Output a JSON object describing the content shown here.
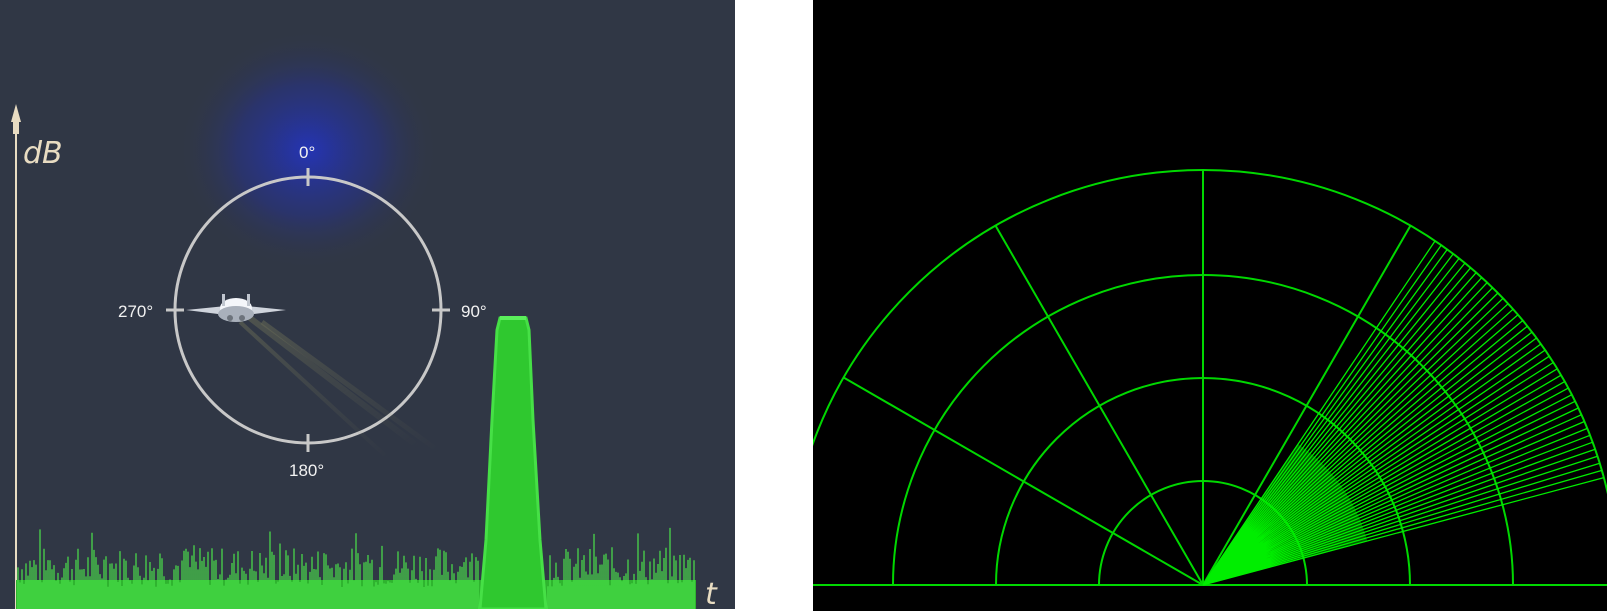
{
  "left_panel": {
    "y_axis_label": "dB",
    "x_axis_label": "t",
    "compass": {
      "north": "0°",
      "east": "90°",
      "south": "180°",
      "west": "270°"
    },
    "colors": {
      "background": "#303745",
      "signal": "#3ddc3d",
      "axis": "#e8dcc2",
      "compass_ring": "#c8c8c8",
      "glow": "#1f2fb0"
    },
    "target_icon": "aircraft-icon"
  },
  "right_panel": {
    "colors": {
      "background": "#000000",
      "grid": "#00d800",
      "sweep": "#00ff00"
    },
    "range_rings": 4,
    "spokes_deg": [
      0,
      30,
      60,
      90,
      120,
      150,
      180
    ],
    "sweep_icon": "radar-sweep-icon"
  }
}
